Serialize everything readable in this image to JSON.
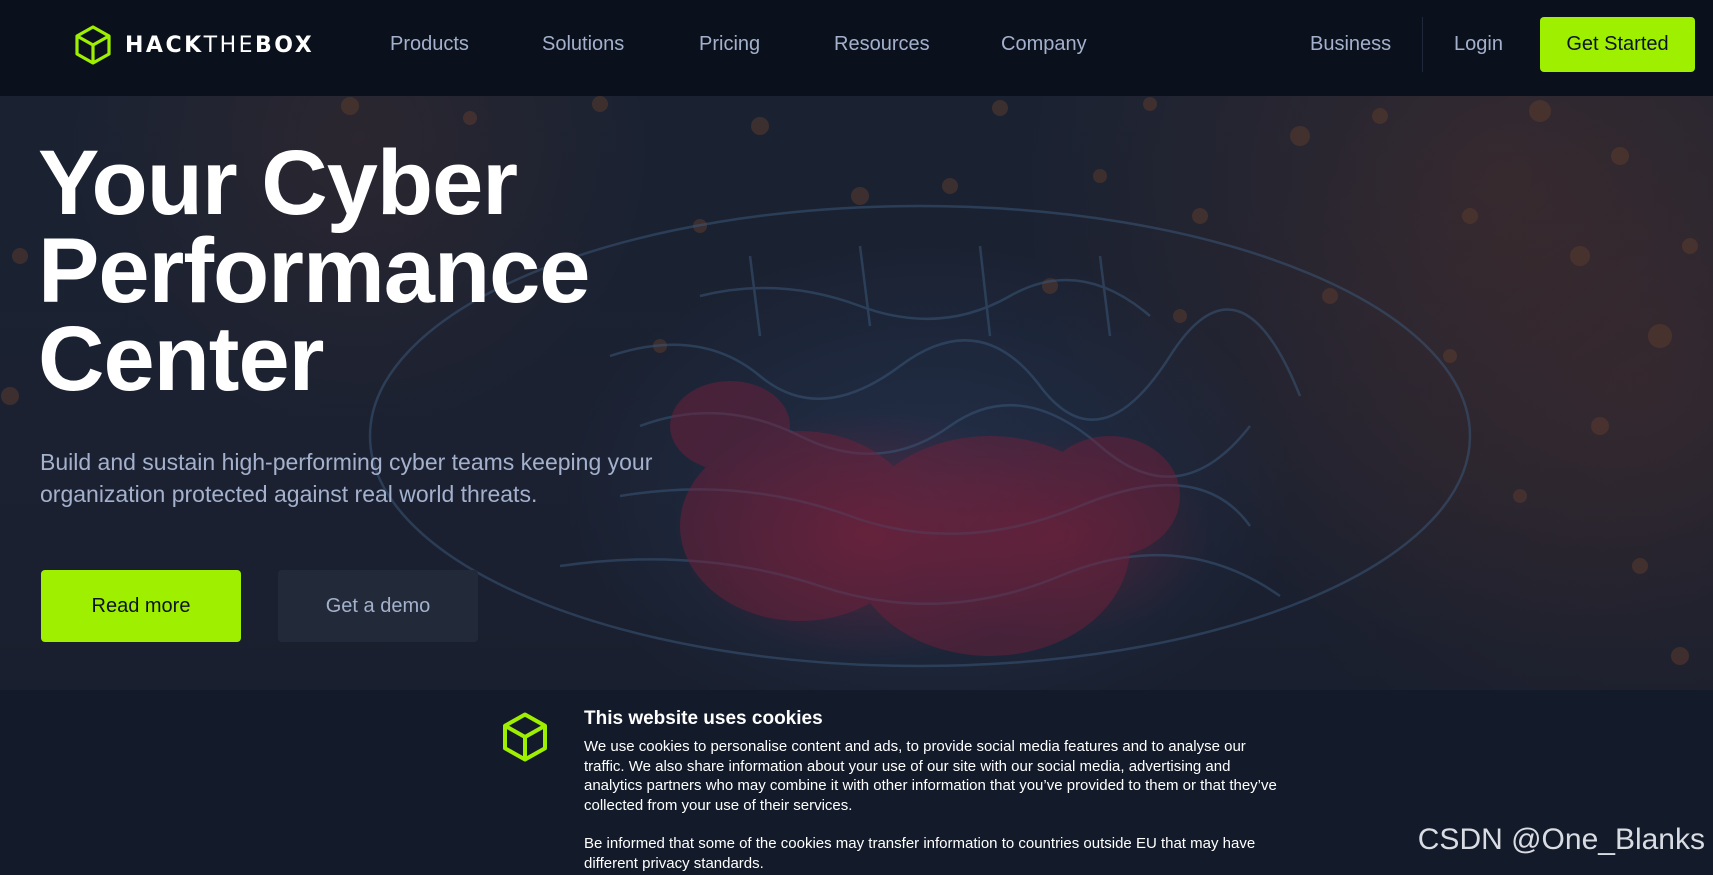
{
  "nav": {
    "logo": {
      "text_bold_1": "HACK",
      "text_thin": "THE",
      "text_bold_2": "BOX",
      "icon": "cube-logo-icon"
    },
    "links": [
      "Products",
      "Solutions",
      "Pricing",
      "Resources",
      "Company"
    ],
    "business_label": "Business",
    "login_label": "Login",
    "get_started_label": "Get Started"
  },
  "hero": {
    "title_lines": [
      "Your Cyber",
      "Performance",
      "Center"
    ],
    "subtitle": "Build and sustain high-performing cyber teams keeping your organization protected against real world threats.",
    "read_more_label": "Read more",
    "demo_label": "Get a demo"
  },
  "cookie": {
    "icon": "cube-logo-icon",
    "title": "This website uses cookies",
    "paragraph_1": "We use cookies to personalise content and ads, to provide social media features and to analyse our traffic. We also share information about your use of our site with our social media, advertising and analytics partners who may combine it with other information that you’ve provided to them or that they’ve collected from your use of their services.",
    "paragraph_2": "Be informed that some of the cookies may transfer information to countries outside EU that may have different privacy standards."
  },
  "watermark": "CSDN @One_Blanks",
  "colors": {
    "accent": "#9fef00",
    "nav_bg": "#0b111c",
    "link": "#a4b1cd",
    "banner_bg": "#131b2a"
  }
}
